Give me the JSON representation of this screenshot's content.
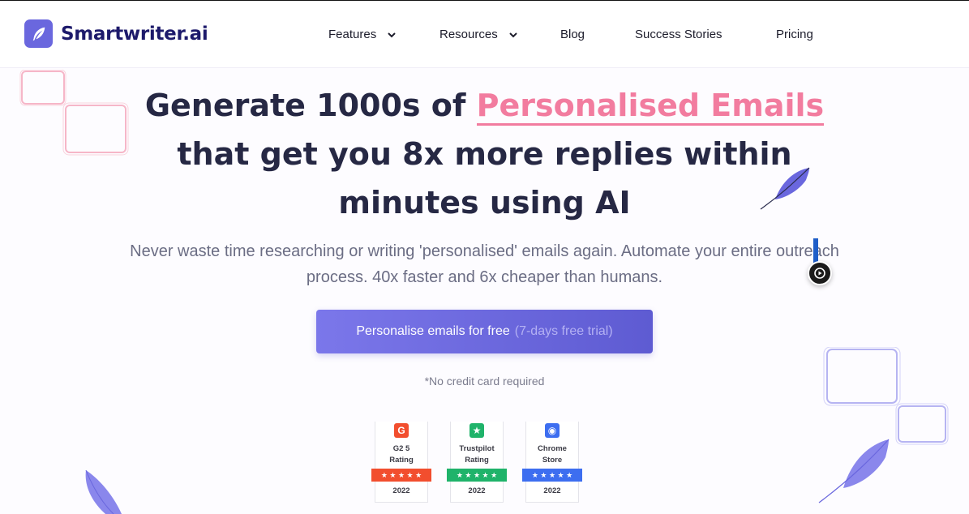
{
  "brand": {
    "name": "Smartwriter.ai",
    "logo_icon": "feather-icon",
    "color": "#6a67de"
  },
  "nav": {
    "features": "Features",
    "resources": "Resources",
    "blog": "Blog",
    "success_stories": "Success Stories",
    "pricing": "Pricing"
  },
  "hero": {
    "title_before": "Generate 1000s of",
    "title_accent": "Personalised Emails",
    "title_after": "that get you 8x more replies within minutes using AI",
    "subtitle": "Never waste time researching or writing 'personalised' emails again. Automate your entire outreach process. 40x faster and 6x cheaper than humans.",
    "accent_color": "#f27c9f"
  },
  "cta": {
    "label": "Personalise emails for free",
    "trial": "(7-days free trial)",
    "note": "*No credit card required"
  },
  "badges": [
    {
      "name": "G2 5",
      "sub": "Rating",
      "year": "2022",
      "color": "#f24e2e",
      "icon": "g2-icon",
      "stars": 5
    },
    {
      "name": "Trustpilot",
      "sub": "Rating",
      "year": "2022",
      "color": "#1fb36a",
      "icon": "trustpilot-star-icon",
      "stars": 5
    },
    {
      "name": "Chrome",
      "sub": "Store",
      "year": "2022",
      "color": "#3d6ef0",
      "icon": "chrome-store-icon",
      "stars": 5
    }
  ]
}
